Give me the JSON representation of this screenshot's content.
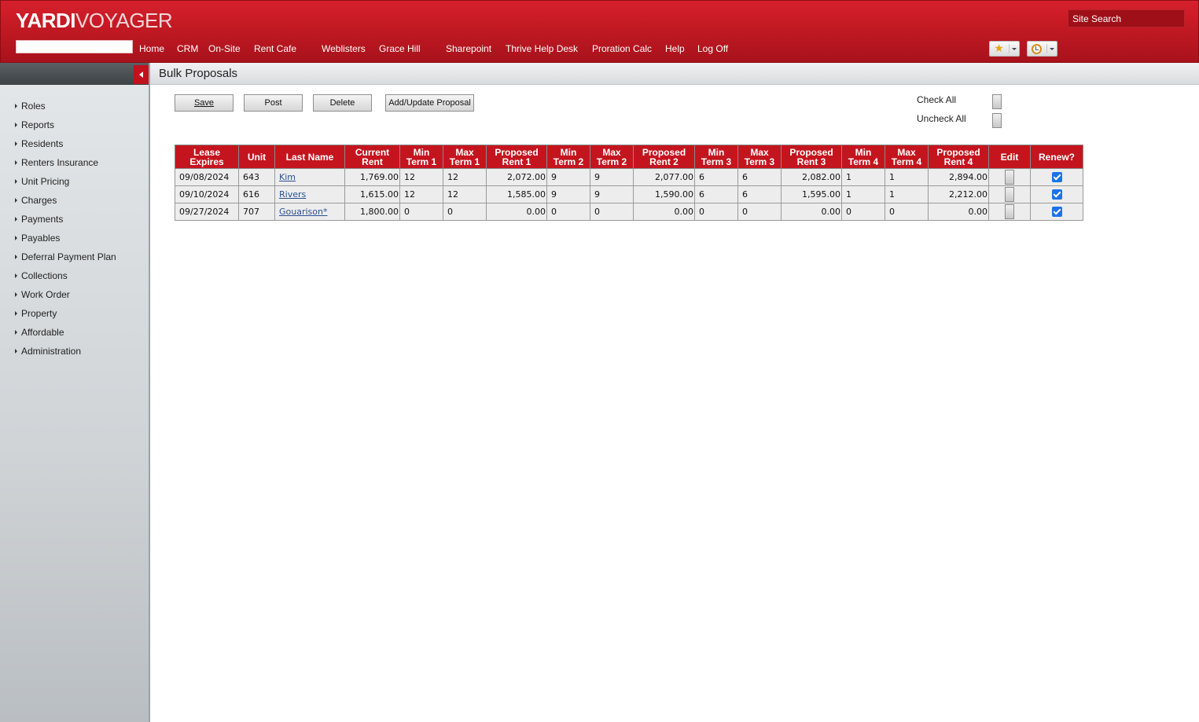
{
  "header": {
    "logo_primary": "YARDI",
    "logo_secondary": "VOYAGER",
    "site_search_placeholder": "Site Search",
    "property_value": "",
    "nav": [
      "Home",
      "CRM",
      "On-Site",
      "Rent Cafe",
      "Weblisters",
      "Grace Hill",
      "Sharepoint",
      "Thrive Help Desk",
      "Proration Calc",
      "Help",
      "Log Off"
    ],
    "favorites_icon": "star-icon",
    "history_icon": "clock-icon"
  },
  "sidebar": {
    "items": [
      "Roles",
      "Reports",
      "Residents",
      "Renters Insurance",
      "Unit Pricing",
      "Charges",
      "Payments",
      "Payables",
      "Deferral Payment Plan",
      "Collections",
      "Work Order",
      "Property",
      "Affordable",
      "Administration"
    ]
  },
  "page": {
    "title": "Bulk Proposals",
    "buttons": {
      "save": "Save",
      "post": "Post",
      "delete": "Delete",
      "add_update": "Add/Update Proposal"
    },
    "check_all": "Check All",
    "uncheck_all": "Uncheck All"
  },
  "table": {
    "headers": [
      [
        "Lease",
        "Expires"
      ],
      [
        "Unit"
      ],
      [
        "Last Name"
      ],
      [
        "Current",
        "Rent"
      ],
      [
        "Min",
        "Term 1"
      ],
      [
        "Max",
        "Term 1"
      ],
      [
        "Proposed",
        "Rent 1"
      ],
      [
        "Min",
        "Term 2"
      ],
      [
        "Max",
        "Term 2"
      ],
      [
        "Proposed",
        "Rent 2"
      ],
      [
        "Min",
        "Term 3"
      ],
      [
        "Max",
        "Term 3"
      ],
      [
        "Proposed",
        "Rent 3"
      ],
      [
        "Min",
        "Term 4"
      ],
      [
        "Max",
        "Term 4"
      ],
      [
        "Proposed",
        "Rent 4"
      ],
      [
        "Edit"
      ],
      [
        "Renew?"
      ]
    ],
    "rows": [
      {
        "lease_expires": "09/08/2024",
        "unit": "643",
        "last_name": "Kim",
        "current_rent": "1,769.00",
        "min1": "12",
        "max1": "12",
        "rent1": "2,072.00",
        "min2": "9",
        "max2": "9",
        "rent2": "2,077.00",
        "min3": "6",
        "max3": "6",
        "rent3": "2,082.00",
        "min4": "1",
        "max4": "1",
        "rent4": "2,894.00",
        "renew": true
      },
      {
        "lease_expires": "09/10/2024",
        "unit": "616",
        "last_name": "Rivers",
        "current_rent": "1,615.00",
        "min1": "12",
        "max1": "12",
        "rent1": "1,585.00",
        "min2": "9",
        "max2": "9",
        "rent2": "1,590.00",
        "min3": "6",
        "max3": "6",
        "rent3": "1,595.00",
        "min4": "1",
        "max4": "1",
        "rent4": "2,212.00",
        "renew": true
      },
      {
        "lease_expires": "09/27/2024",
        "unit": "707",
        "last_name": "Gouarison*",
        "current_rent": "1,800.00",
        "min1": "0",
        "max1": "0",
        "rent1": "0.00",
        "min2": "0",
        "max2": "0",
        "rent2": "0.00",
        "min3": "0",
        "max3": "0",
        "rent3": "0.00",
        "min4": "0",
        "max4": "0",
        "rent4": "0.00",
        "renew": true
      }
    ]
  }
}
